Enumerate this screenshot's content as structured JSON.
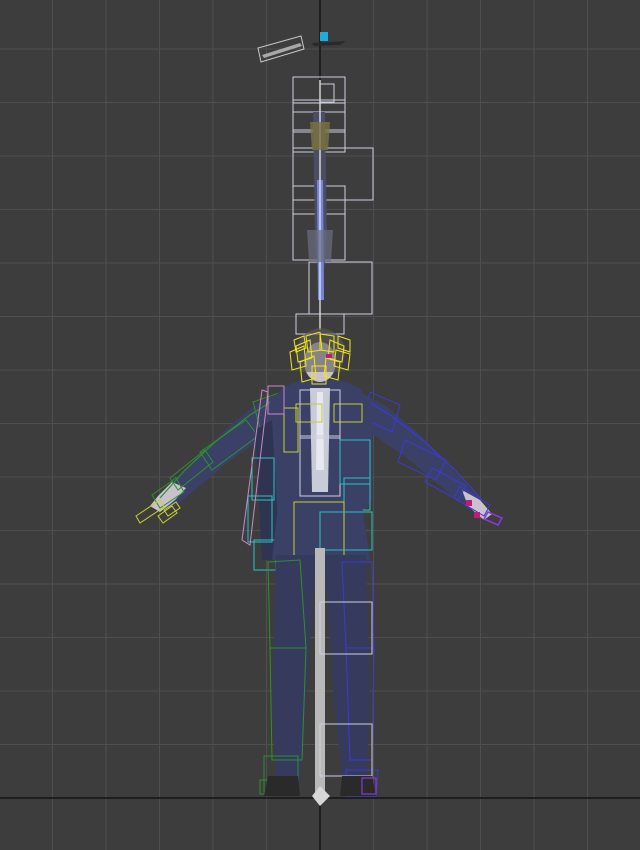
{
  "viewport": {
    "view": "front",
    "background": "#3d3d3d",
    "grid": {
      "visible": true,
      "color": "#4f4f4f",
      "axis_color": "#141414"
    }
  },
  "scene": {
    "model": "character-t-pose",
    "colors": {
      "suit": "#3a4066",
      "skin": "#c9c2cc",
      "bone": "#b9b9b9",
      "hair_bones": "#f2e51b",
      "spine_boxes": "#cfcfe0",
      "left_arm_bones": "#2f8f2f",
      "right_arm_bones": "#3a3ad6",
      "coat_bones": "#28c5c5",
      "finger_bones": "#c9d12a",
      "right_hand_accent": "#c01a7a",
      "ponytail_bone": "#6f7fd8",
      "pink_outline": "#cc88cc"
    },
    "props": {
      "floating_weapon": "weapon-gizmo",
      "weapon_marker": "#22aadd"
    }
  }
}
